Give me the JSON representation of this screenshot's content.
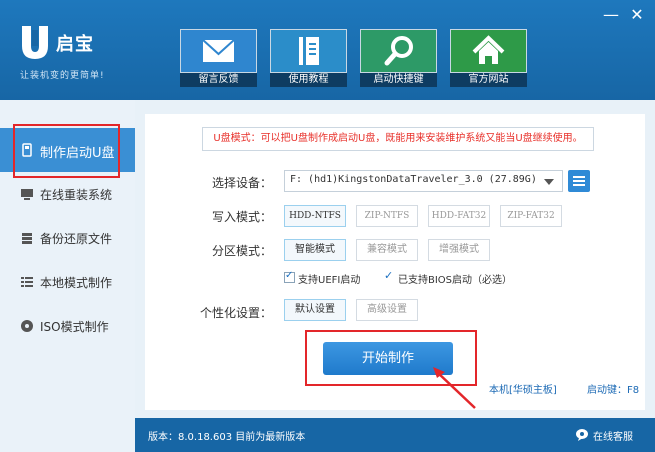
{
  "window": {
    "app_name": "启宝",
    "slogan": "让装机变的更简单!",
    "minimize_glyph": "—",
    "close_glyph": "✕"
  },
  "top_buttons": [
    {
      "label": "留言反馈",
      "icon": "mail-icon"
    },
    {
      "label": "使用教程",
      "icon": "book-icon"
    },
    {
      "label": "启动快捷键",
      "icon": "search-icon"
    },
    {
      "label": "官方网站",
      "icon": "home-icon"
    }
  ],
  "sidebar": {
    "items": [
      {
        "label": "制作启动U盘",
        "icon": "usb-drive-icon",
        "active": true
      },
      {
        "label": "在线重装系统",
        "icon": "monitor-icon",
        "active": false
      },
      {
        "label": "备份还原文件",
        "icon": "backup-icon",
        "active": false
      },
      {
        "label": "本地模式制作",
        "icon": "list-icon",
        "active": false
      },
      {
        "label": "ISO模式制作",
        "icon": "disc-icon",
        "active": false
      }
    ]
  },
  "main": {
    "notice": "U盘模式：可以把U盘制作成启动U盘，既能用来安装维护系统又能当U盘继续使用。",
    "device": {
      "label": "选择设备：",
      "value": "F: (hd1)KingstonDataTraveler_3.0 (27.89G)"
    },
    "write_mode": {
      "label": "写入模式：",
      "options": [
        "HDD-NTFS",
        "ZIP-NTFS",
        "HDD-FAT32",
        "ZIP-FAT32"
      ],
      "selected": 0
    },
    "partition_mode": {
      "label": "分区模式：",
      "options": [
        "智能模式",
        "兼容模式",
        "增强模式"
      ],
      "selected": 0
    },
    "checks": {
      "uefi": "支持UEFI启动",
      "bios": "已支持BIOS启动（必选）"
    },
    "personalize": {
      "label": "个性化设置：",
      "options": [
        "默认设置",
        "高级设置"
      ],
      "selected": 0
    },
    "start_button": "开始制作",
    "device_info": "本机[华硕主板]",
    "hotkey": "启动键：F8"
  },
  "footer": {
    "version": "版本：8.0.18.603 目前为最新版本",
    "support": "在线客服"
  },
  "colors": {
    "header": "#1766a5",
    "accent": "#2f8ad6",
    "highlight_red": "#e3262a",
    "notice_red": "#e8312b"
  }
}
